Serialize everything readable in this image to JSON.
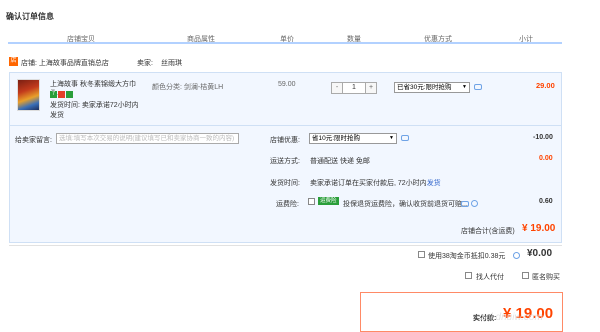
{
  "page": {
    "title": "确认订单信息"
  },
  "table_headers": [
    "店铺宝贝",
    "商品属性",
    "单价",
    "数量",
    "优惠方式",
    "小计"
  ],
  "shop": {
    "icon_text": "店",
    "label": "店铺: 上海故事品牌直销总店",
    "seller_label": "卖家:",
    "seller_name": "丝雨琪"
  },
  "item": {
    "title": "上海故事 秋冬素锦缎大方巾头...",
    "badge_text": "7",
    "shipping_time": "发货时间: 卖家承诺72小时内发货",
    "attributes": "颜色分类: 剑澜-桔黄LH",
    "unit_price": "59.00",
    "quantity": "1",
    "qty_minus": "-",
    "qty_plus": "+",
    "discount_option": "已省30元:限时抢购",
    "subtotal": "29.00"
  },
  "message": {
    "label": "给卖家留言:",
    "placeholder": "选填:填写本次交易的说明(建议填写已和卖家协商一致的内容)"
  },
  "shop_discount": {
    "label": "店铺优惠:",
    "option": "省10元:限时抢购",
    "amount": "-10.00"
  },
  "delivery": {
    "label": "运送方式:",
    "value": "普通配送 快递 免邮",
    "amount": "0.00"
  },
  "dispatch": {
    "label": "发货时间:",
    "value": "卖家承诺订单在买家付款后, 72小时内",
    "link": "发货"
  },
  "insurance": {
    "label": "运费险:",
    "tag": "运费险",
    "value": "投保退货运费险，确认收货前退货可赔...",
    "amount": "0.60"
  },
  "shop_total": {
    "label": "店铺合计(含运费)",
    "amount": "¥ 19.00"
  },
  "coins": {
    "label": "使用38淘金币抵扣0.38元",
    "amount": "¥0.00"
  },
  "options": {
    "proxy_label": "找人代付",
    "anonymous_label": "匿名购买"
  },
  "payment": {
    "label": "实付款:",
    "amount": "¥ 19.00",
    "watermark": "zol.dnuiw.com"
  },
  "colors": {
    "accent": "#ff4400",
    "header_line": "#b2d1ff",
    "block_bg": "#f2f7ff"
  }
}
